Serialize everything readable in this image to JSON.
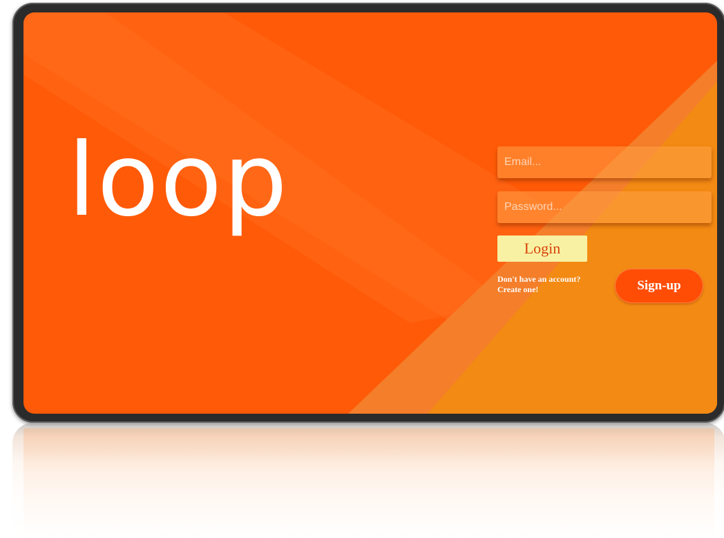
{
  "app": {
    "logo_text": "loop"
  },
  "login_form": {
    "email_placeholder": "Email...",
    "password_placeholder": "Password...",
    "login_label": "Login",
    "no_account_line1": "Don't have an account?",
    "no_account_line2": "Create one!",
    "signup_label": "Sign-up"
  },
  "colors": {
    "background_orange": "#ff5a07",
    "accent_light_orange": "#f79a2c",
    "login_button_bg": "#f8f1a3",
    "login_button_text": "#d9440a",
    "signup_button_bg": "#ff4d05",
    "device_frame": "#2b2b2b"
  }
}
